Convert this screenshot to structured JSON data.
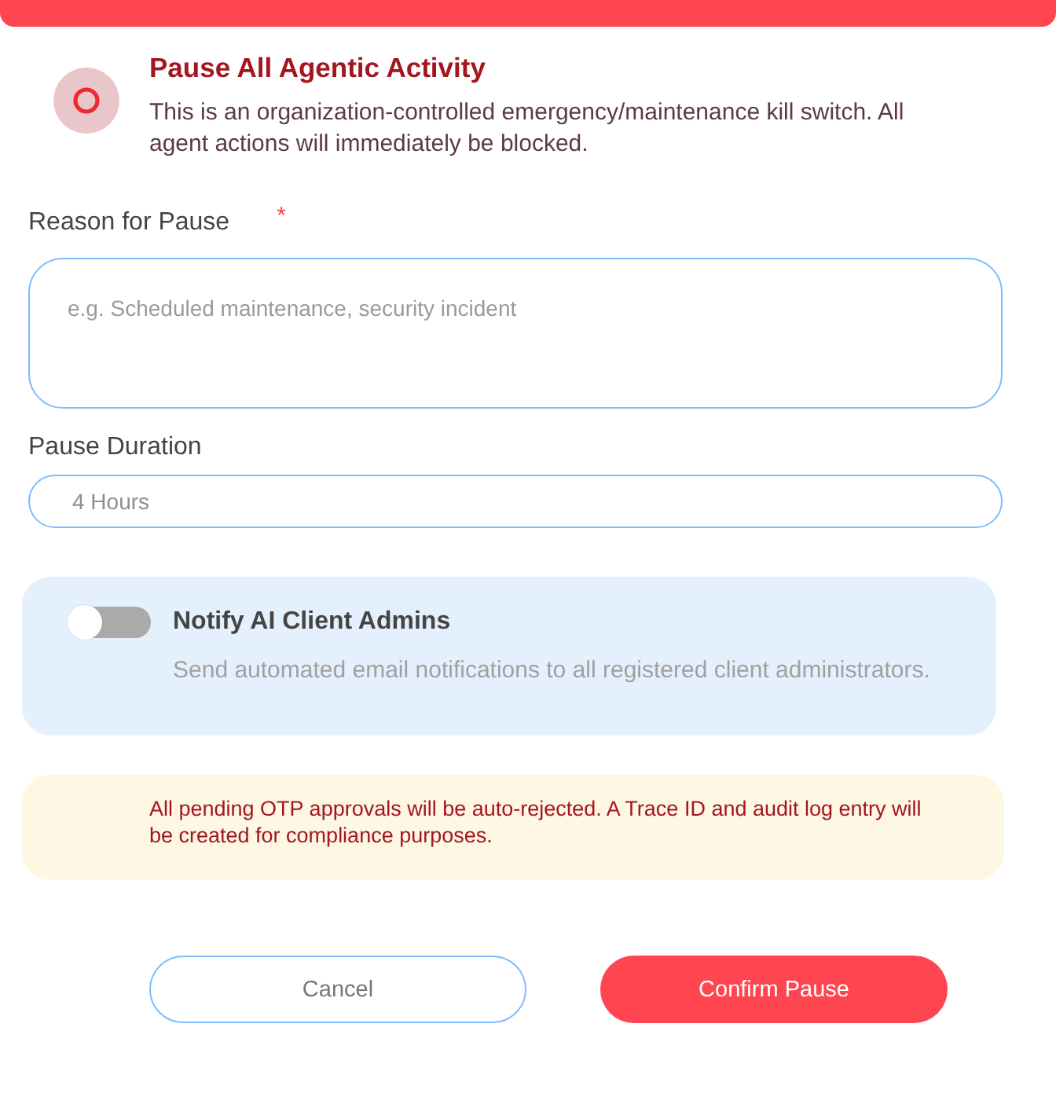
{
  "header": {
    "title": "Pause All Agentic Activity",
    "description": "This is an organization-controlled emergency/maintenance kill switch. All agent actions will immediately be blocked."
  },
  "reason": {
    "label": "Reason for Pause",
    "required_mark": "*",
    "placeholder": "e.g. Scheduled maintenance, security incident"
  },
  "duration": {
    "label": "Pause Duration",
    "value": "4 Hours"
  },
  "notify": {
    "title": "Notify AI Client Admins",
    "description": "Send automated email notifications to all registered client administrators.",
    "on": false
  },
  "warning": {
    "text": "All pending OTP approvals will be auto-rejected. A Trace ID and audit log entry will be created for compliance purposes."
  },
  "buttons": [
    {
      "label": "Cancel",
      "kind": "secondary"
    },
    {
      "label": "Confirm Pause",
      "kind": "primary"
    }
  ]
}
